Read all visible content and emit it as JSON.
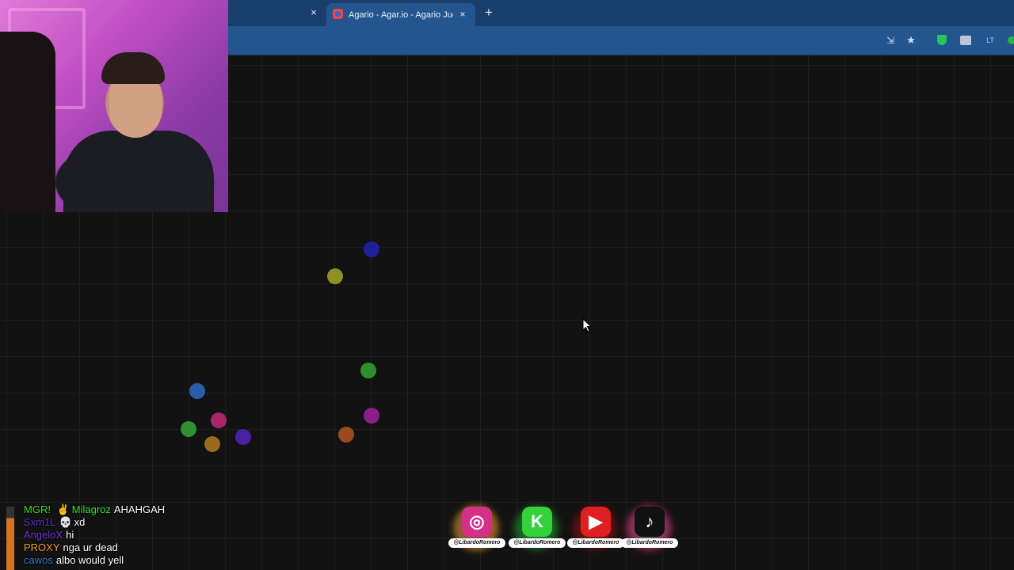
{
  "browser": {
    "prev_tab_close": "×",
    "active_tab": {
      "title": "Agario - Agar.io - Agario Juegos",
      "close": "×"
    },
    "new_tab": "+",
    "toolbar_icons": [
      "install-app-icon",
      "bookmark-star-icon",
      "shield-extension-icon",
      "extension-icon",
      "text-extension-icon",
      "status-dot-icon"
    ],
    "theme_color": "#23558f"
  },
  "game": {
    "background": "#121212",
    "grid_color": "#1e1e1e",
    "pellets": [
      {
        "color": "#1f1f9a"
      },
      {
        "color": "#8f8f24"
      },
      {
        "color": "#2f8f2f"
      },
      {
        "color": "#2a5ea8"
      },
      {
        "color": "#8a1f8a"
      },
      {
        "color": "#2f8f33"
      },
      {
        "color": "#a8246b"
      },
      {
        "color": "#4a1fa0"
      },
      {
        "color": "#9a6a1f"
      },
      {
        "color": "#9a4a1f"
      }
    ]
  },
  "chat": {
    "messages": [
      {
        "user": "MGR! ",
        "emoji": "✌",
        "user2": "Milagroz",
        "text": "AHAHGAH",
        "user_color": "#34e234",
        "user2_color": "#34e234"
      },
      {
        "user": "Sxm1L",
        "emoji": "💀",
        "text": "xd",
        "user_color": "#5a2fd6"
      },
      {
        "user": "AngeloX",
        "text": "hi",
        "user_color": "#7a2fe0"
      },
      {
        "user": "PROXY",
        "text": "nga ur dead",
        "user_color": "#f0a020"
      },
      {
        "user": "cawos",
        "text": "albo would yell",
        "user_color": "#2f7ad6"
      }
    ]
  },
  "socials": [
    {
      "name": "instagram",
      "glyph": "◎",
      "handle": "@LibardoRomero",
      "color": "#d62f8a"
    },
    {
      "name": "kick",
      "glyph": "K",
      "handle": "@LibardoRomero",
      "color": "#34d23a"
    },
    {
      "name": "youtube",
      "glyph": "▶",
      "handle": "@LibardoRomero",
      "color": "#e02020"
    },
    {
      "name": "tiktok",
      "glyph": "♪",
      "handle": "@LibardoRomero",
      "color": "#111111"
    }
  ]
}
